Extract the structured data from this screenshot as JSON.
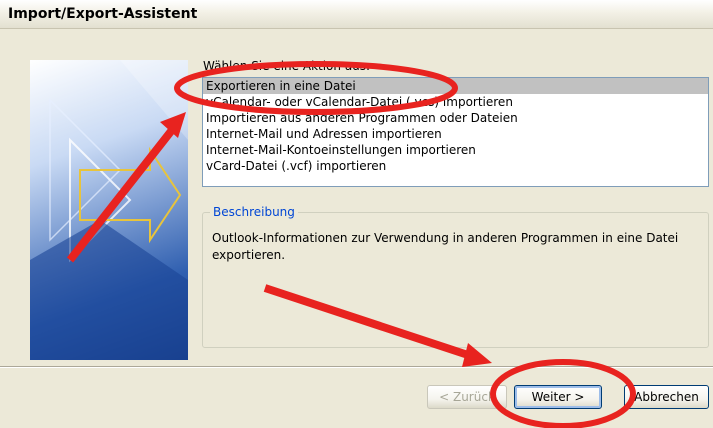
{
  "window": {
    "title": "Import/Export-Assistent"
  },
  "prompt": "Wählen Sie eine Aktion aus:",
  "actions": [
    {
      "label": "Exportieren in eine Datei",
      "selected": true
    },
    {
      "label": "vCalendar- oder vCalendar-Datei (.vcs) importieren",
      "selected": false
    },
    {
      "label": "Importieren aus anderen Programmen oder Dateien",
      "selected": false
    },
    {
      "label": "Internet-Mail und Adressen importieren",
      "selected": false
    },
    {
      "label": "Internet-Mail-Kontoeinstellungen importieren",
      "selected": false
    },
    {
      "label": "vCard-Datei (.vcf) importieren",
      "selected": false
    }
  ],
  "description": {
    "label": "Beschreibung",
    "text": "Outlook-Informationen zur Verwendung in anderen Programmen in eine Datei exportieren."
  },
  "buttons": {
    "back": "< Zurück",
    "next": "Weiter >",
    "cancel": "Abbrechen"
  },
  "colors": {
    "annotation": "#e8231f",
    "selection": "#c1c1c1",
    "group_label": "#0046d5"
  }
}
